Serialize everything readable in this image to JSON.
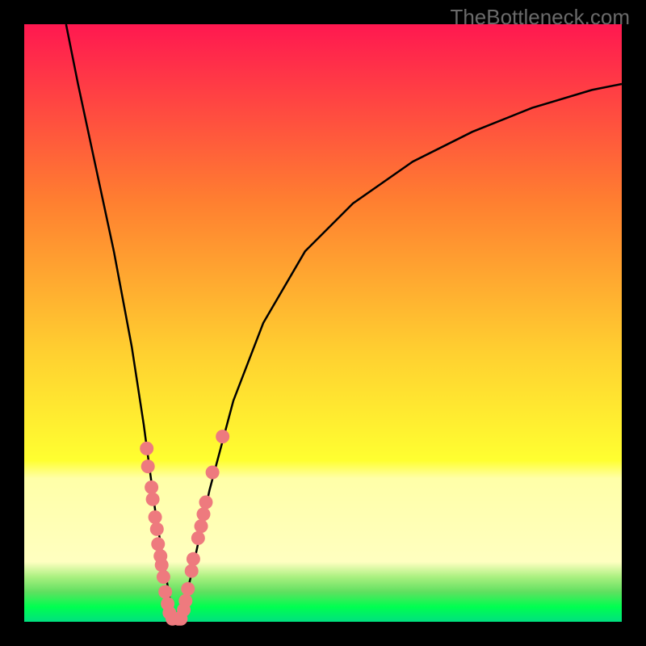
{
  "attribution": "TheBottleneck.com",
  "colors": {
    "border": "#000000",
    "curve": "#000000",
    "dots": "#ee7a7e",
    "dots_stroke": "#d9605f",
    "gradient_top": "#ff1850",
    "gradient_mid1": "#ff8030",
    "gradient_mid2": "#ffd030",
    "gradient_midyellow": "#ffff30",
    "gradient_palesection_top": "#ffffa8",
    "gradient_palesection_bottom": "#ffffc0",
    "gradient_green1": "#aaf080",
    "gradient_green2": "#60e060",
    "gradient_green3": "#00ff50",
    "gradient_lastgreen": "#00e080"
  },
  "chart_data": {
    "type": "line",
    "title": "",
    "xlabel": "",
    "ylabel": "",
    "x_range": [
      0,
      100
    ],
    "y_range": [
      0,
      100
    ],
    "x_minimum": 25,
    "curve_points": [
      {
        "x": 7,
        "y": 100
      },
      {
        "x": 9,
        "y": 90
      },
      {
        "x": 12,
        "y": 76
      },
      {
        "x": 15,
        "y": 62
      },
      {
        "x": 18,
        "y": 46
      },
      {
        "x": 20,
        "y": 33
      },
      {
        "x": 22,
        "y": 18
      },
      {
        "x": 24,
        "y": 6
      },
      {
        "x": 25,
        "y": 0
      },
      {
        "x": 26,
        "y": 0
      },
      {
        "x": 28,
        "y": 8
      },
      {
        "x": 31,
        "y": 22
      },
      {
        "x": 35,
        "y": 37
      },
      {
        "x": 40,
        "y": 50
      },
      {
        "x": 47,
        "y": 62
      },
      {
        "x": 55,
        "y": 70
      },
      {
        "x": 65,
        "y": 77
      },
      {
        "x": 75,
        "y": 82
      },
      {
        "x": 85,
        "y": 86
      },
      {
        "x": 95,
        "y": 89
      },
      {
        "x": 100,
        "y": 90
      }
    ],
    "data_dots": [
      {
        "x": 20.5,
        "y": 29
      },
      {
        "x": 20.7,
        "y": 26
      },
      {
        "x": 21.3,
        "y": 22.5
      },
      {
        "x": 21.5,
        "y": 20.5
      },
      {
        "x": 21.9,
        "y": 17.5
      },
      {
        "x": 22.2,
        "y": 15.5
      },
      {
        "x": 22.4,
        "y": 13
      },
      {
        "x": 22.8,
        "y": 11
      },
      {
        "x": 23.0,
        "y": 9.5
      },
      {
        "x": 23.3,
        "y": 7.5
      },
      {
        "x": 23.6,
        "y": 5
      },
      {
        "x": 24.0,
        "y": 3
      },
      {
        "x": 24.3,
        "y": 1.5
      },
      {
        "x": 24.8,
        "y": 0.5
      },
      {
        "x": 25.8,
        "y": 0.5
      },
      {
        "x": 26.2,
        "y": 0.5
      },
      {
        "x": 26.7,
        "y": 2.0
      },
      {
        "x": 27.0,
        "y": 3.5
      },
      {
        "x": 27.4,
        "y": 5.5
      },
      {
        "x": 28.0,
        "y": 8.5
      },
      {
        "x": 28.3,
        "y": 10.5
      },
      {
        "x": 29.1,
        "y": 14
      },
      {
        "x": 29.6,
        "y": 16
      },
      {
        "x": 30.0,
        "y": 18
      },
      {
        "x": 30.4,
        "y": 20
      },
      {
        "x": 31.5,
        "y": 25
      },
      {
        "x": 33.2,
        "y": 31
      }
    ]
  }
}
